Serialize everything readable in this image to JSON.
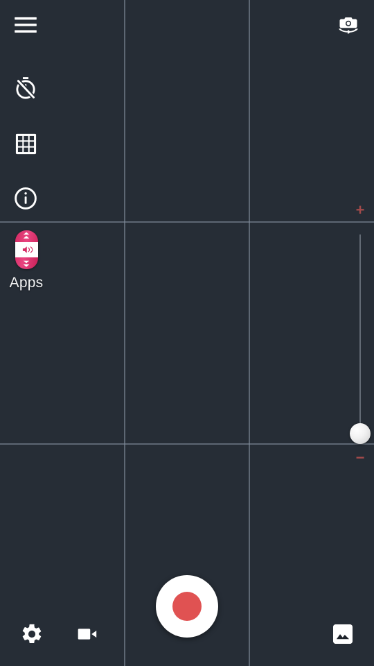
{
  "app": {
    "title": "Camera Recorder",
    "background_color": "#262d36",
    "accent_color": "#e05252"
  },
  "grid_overlay": {
    "enabled": true,
    "name": "rule-of-thirds-grid",
    "line_color": "#808b99",
    "vertical_lines": [
      179,
      359
    ],
    "horizontal_lines": [
      319,
      639
    ]
  },
  "left_rail": {
    "items": [
      {
        "name": "menu-icon",
        "label": "Menu"
      },
      {
        "name": "timer-off-icon",
        "label": "Timer off"
      },
      {
        "name": "grid-icon",
        "label": "Grid"
      },
      {
        "name": "info-icon",
        "label": "Info"
      }
    ]
  },
  "top_bar": {
    "switch_camera": {
      "name": "switch-camera-icon",
      "label": "Switch camera"
    }
  },
  "apps_shortcut": {
    "label": "Apps",
    "icon_name": "volume-rocker-app-icon",
    "icon_color": "#d42a63",
    "speaker_glyph": "speaker-icon"
  },
  "zoom_slider": {
    "name": "zoom-slider",
    "plus_label": "+",
    "minus_label": "−",
    "control_color": "#a14a4a",
    "track_color": "#6d757f",
    "thumb_position_pct": 94,
    "orientation": "vertical"
  },
  "record": {
    "name": "record-button",
    "label": "Record",
    "dot_color": "#e05252",
    "ring_color": "#ffffff"
  },
  "bottom_bar": {
    "items": [
      {
        "name": "settings-icon",
        "label": "Settings"
      },
      {
        "name": "video-camera-icon",
        "label": "Video mode"
      },
      {
        "name": "gallery-icon",
        "label": "Gallery"
      }
    ]
  }
}
